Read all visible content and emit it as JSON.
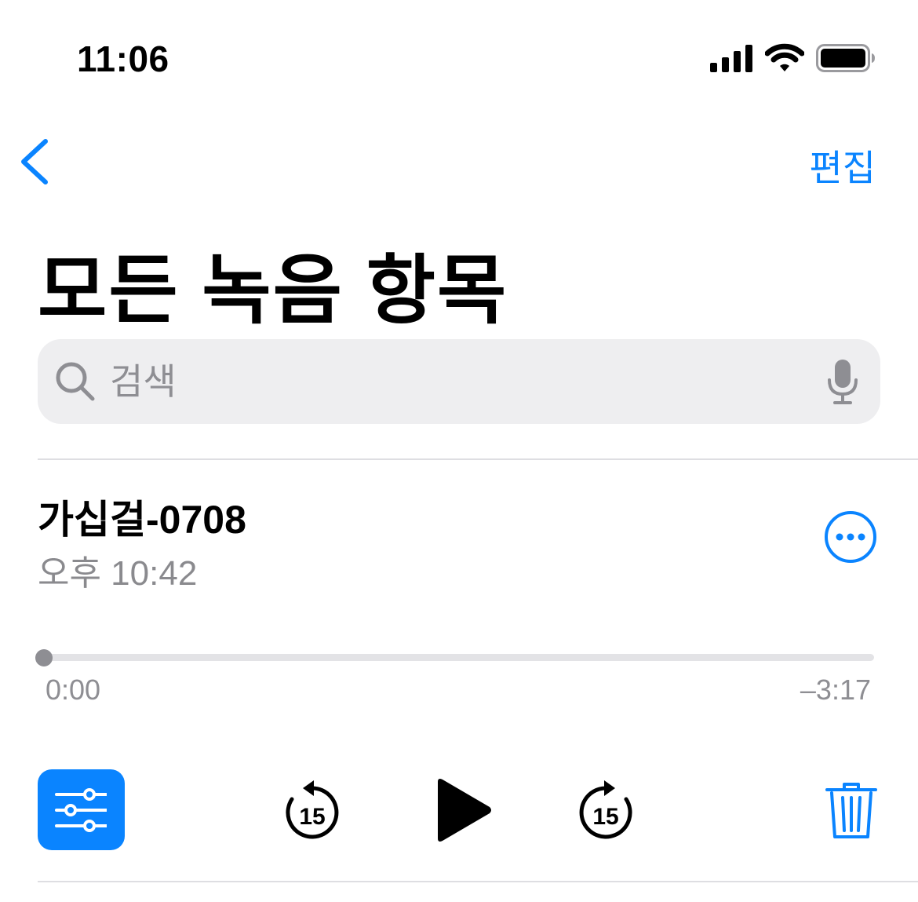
{
  "status_bar": {
    "time": "11:06",
    "icons": [
      "cellular-signal-icon",
      "wifi-icon",
      "battery-icon"
    ]
  },
  "nav": {
    "back_icon": "chevron-left-icon",
    "edit_label": "편집"
  },
  "page": {
    "title": "모든 녹음 항목"
  },
  "search": {
    "placeholder": "검색",
    "value": "",
    "icons": [
      "magnifying-glass-icon",
      "microphone-icon"
    ]
  },
  "recording": {
    "title": "가십걸-0708",
    "timestamp": "오후 10:42",
    "more_icon": "ellipsis-circle-icon",
    "progress": 0,
    "elapsed": "0:00",
    "remaining": "–3:17"
  },
  "controls": {
    "settings_icon": "sliders-icon",
    "skip_back_icon": "skip-back-15-icon",
    "skip_back_label": "15",
    "play_icon": "play-icon",
    "skip_forward_icon": "skip-forward-15-icon",
    "skip_forward_label": "15",
    "delete_icon": "trash-icon"
  },
  "colors": {
    "accent": "#0A84FF",
    "secondary_text": "#8E8E93",
    "search_background": "#EEEEF0"
  }
}
